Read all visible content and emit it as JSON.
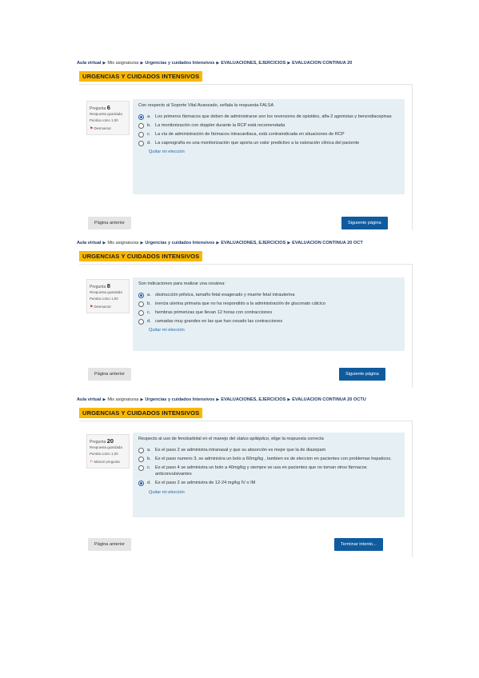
{
  "course_title": "URGENCIAS Y CUIDADOS INTENSIVOS",
  "breadcrumb_items": [
    "Aula virtual",
    "Mis asignaturas",
    "Urgencias y cuidados Intensivos",
    "EVALUACIONES, EJERCICIOS"
  ],
  "info": {
    "question_word": "Pregunta",
    "status_saved": "Respuesta guardada",
    "score": "Puntúa como 1,00",
    "unflag": "Desmarcar",
    "flag": "Marcar pregunta"
  },
  "clear_choice": "Quitar mi elección",
  "prev_button": "Página anterior",
  "sections": [
    {
      "crumb_last": "EVALUACIÓN CONTINUA 20",
      "question_number": "6",
      "flag_label": "Desmarcar",
      "question_text": "Con respecto al Soporte Vital Avanzado, señala la respuesta FALSA",
      "options": [
        {
          "letter": "a.",
          "text": "Los primeros fármacos que deben de administrarse son los reversores de opioides, alfa-2 agonistas y benzodiacepinas",
          "selected": true
        },
        {
          "letter": "b.",
          "text": "La monitorización con doppler durante la RCP está recomendada",
          "selected": false
        },
        {
          "letter": "c.",
          "text": "La vía de administración de fármacos intracardiaca, está contraindicada en situaciones de RCP",
          "selected": false
        },
        {
          "letter": "d.",
          "text": "La capnografía es una monitorización que aporta un valor predictivo a la valoración clínica del paciente",
          "selected": false
        }
      ],
      "next_button": "Siguiente página"
    },
    {
      "crumb_last": "EVALUACIÓN CONTINUA 20 OCT",
      "question_number": "8",
      "flag_label": "Desmarcar",
      "question_text": "Son indicaciones para realizar una cesárea:",
      "options": [
        {
          "letter": "a.",
          "text": "obstrucción pélvica, tamaño fetal exagerado y muerte fetal intrauterina",
          "selected": true
        },
        {
          "letter": "b.",
          "text": "inercia uterina primaria que no ha respondido a la administración de gluconato cálcico",
          "selected": false
        },
        {
          "letter": "c.",
          "text": "hembras primerizas que llevan 12 horas con contracciones",
          "selected": false
        },
        {
          "letter": "d.",
          "text": "camadas muy grandes en las que han cesado las contracciones",
          "selected": false
        }
      ],
      "next_button": "Siguiente página"
    },
    {
      "crumb_last": "EVALUACIÓN CONTINUA 20 OCTU",
      "question_number": "20",
      "flag_label": "Marcar pregunta",
      "question_text_pre": "Respecto al uso de fenobarbital en el manejo del ",
      "question_text_em": "status epiléptico",
      "question_text_post": ", elige la respuesta correcta",
      "options": [
        {
          "letter": "a.",
          "text": "Es el paso 2 se administra intranasal y que su absorción es mejor que la de diazepam",
          "selected": false
        },
        {
          "letter": "b.",
          "text": "Es el paso numero 3, se administra un bolo a 60mg/kg , tambien es de eleccion en pacientes con problemas hepaticos.",
          "selected": false
        },
        {
          "letter": "c.",
          "text": "Es el paso 4 se administra un bolo a 40mg/kg y siempre se usa en pacientes que no toman otros fármacos anticonvulsivantes",
          "selected": false
        },
        {
          "letter": "d.",
          "text": "Es el paso 2 se administra de 12-24 mg/kg IV o IM",
          "selected": true
        }
      ],
      "next_button": "Terminar intento..."
    }
  ]
}
